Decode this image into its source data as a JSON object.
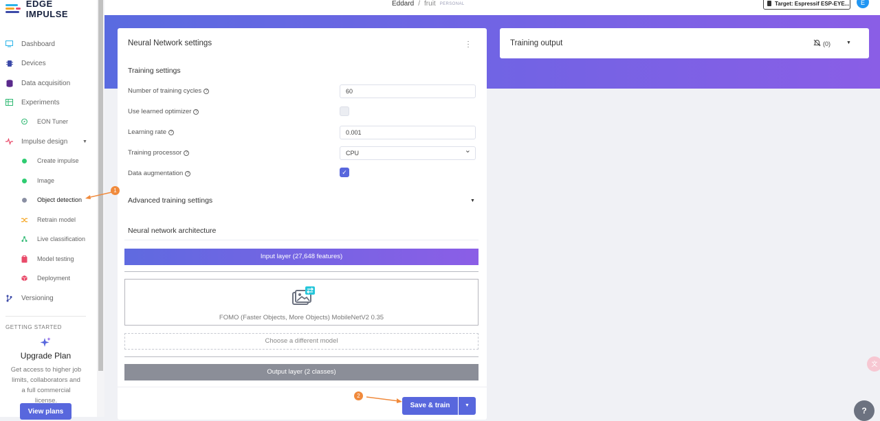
{
  "app": {
    "logo_text": "EDGE IMPULSE"
  },
  "header": {
    "user": "Eddard",
    "separator": "/",
    "project": "fruit",
    "project_badge": "PERSONAL",
    "target_label": "Target: Espressif ESP-EYE...",
    "avatar_initial": "E"
  },
  "sidebar": {
    "items": [
      {
        "label": "Dashboard"
      },
      {
        "label": "Devices"
      },
      {
        "label": "Data acquisition"
      },
      {
        "label": "Experiments"
      },
      {
        "label": "EON Tuner"
      },
      {
        "label": "Impulse design"
      },
      {
        "label": "Create impulse"
      },
      {
        "label": "Image"
      },
      {
        "label": "Object detection"
      },
      {
        "label": "Retrain model"
      },
      {
        "label": "Live classification"
      },
      {
        "label": "Model testing"
      },
      {
        "label": "Deployment"
      },
      {
        "label": "Versioning"
      }
    ],
    "getting_started": "GETTING STARTED",
    "upgrade_title": "Upgrade Plan",
    "upgrade_desc": "Get access to higher job limits, collaborators and a full commercial license.",
    "view_plans": "View plans"
  },
  "nn": {
    "title": "Neural Network settings",
    "training_settings": "Training settings",
    "cycles_label": "Number of training cycles",
    "cycles_value": "60",
    "optimizer_label": "Use learned optimizer",
    "lr_label": "Learning rate",
    "lr_value": "0.001",
    "processor_label": "Training processor",
    "processor_value": "CPU",
    "augmentation_label": "Data augmentation",
    "advanced": "Advanced training settings",
    "architecture": "Neural network architecture",
    "input_layer": "Input layer (27,648 features)",
    "model": "FOMO (Faster Objects, More Objects) MobileNetV2 0.35",
    "choose_model": "Choose a different model",
    "output_layer": "Output layer (2 classes)",
    "save_train": "Save & train"
  },
  "training_output": {
    "title": "Training output",
    "notifications": "(0)"
  },
  "annotations": {
    "one": "1",
    "two": "2"
  },
  "colors": {
    "accent": "#5867dd",
    "banner_start": "#5a6be0",
    "banner_end": "#8a5ee6",
    "annotation": "#f08a3c"
  }
}
